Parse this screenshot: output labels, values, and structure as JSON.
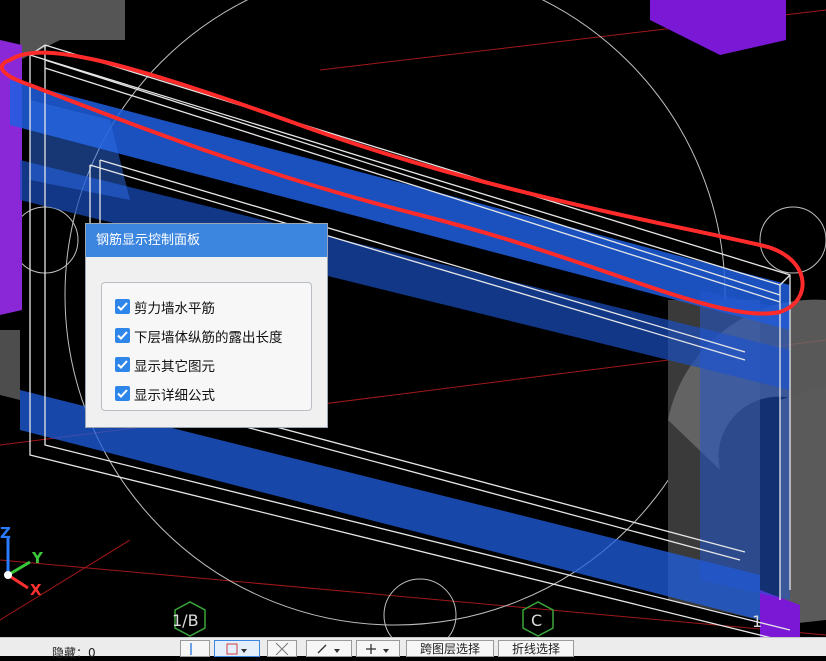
{
  "panel": {
    "title": "钢筋显示控制面板",
    "options": [
      {
        "label": "剪力墙水平筋",
        "checked": true
      },
      {
        "label": "下层墙体纵筋的露出长度",
        "checked": true
      },
      {
        "label": "显示其它图元",
        "checked": true
      },
      {
        "label": "显示详细公式",
        "checked": true
      }
    ]
  },
  "viewport": {
    "grid_labels": [
      "1/B",
      "C",
      "1"
    ],
    "axes": {
      "z": "Z",
      "y": "Y",
      "x": "X"
    }
  },
  "statusbar": {
    "hidden_label": "隐藏：0",
    "cross_layer_select": "跨图层选择",
    "polyline_select": "折线选择"
  },
  "colors": {
    "accent": "#3c86e0",
    "annotation": "#ff2a2a",
    "rebar_blue": "#1f5fe0",
    "column_purple": "#7a18d6"
  }
}
